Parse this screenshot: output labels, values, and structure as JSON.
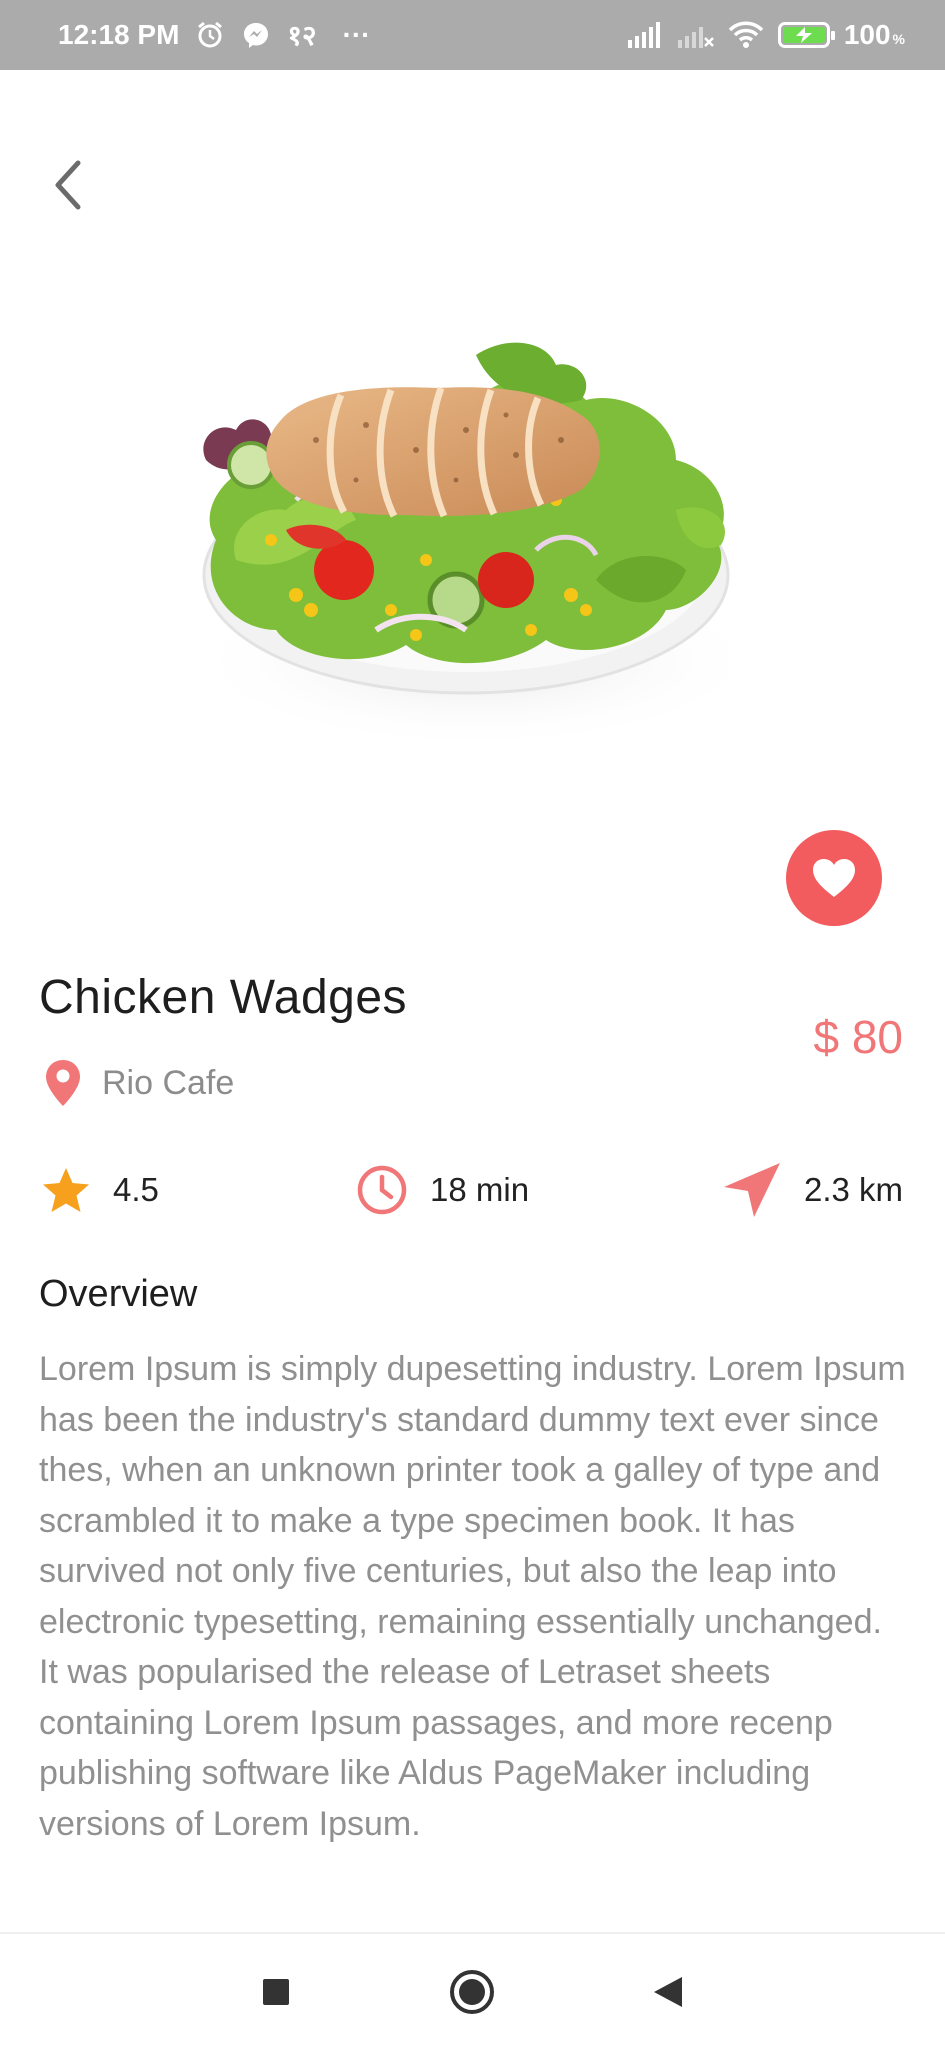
{
  "status_bar": {
    "time": "12:18 PM",
    "extra_icons": [
      "alarm-icon",
      "messenger-icon",
      "network-glyph-icon"
    ],
    "dots": "···",
    "network_glyph": "१२",
    "battery_percent": "100",
    "percent_sign": "%"
  },
  "food": {
    "name": "Chicken Wadges",
    "price": "$ 80",
    "restaurant": "Rio Cafe",
    "is_favorite": true
  },
  "stats": {
    "rating": "4.5",
    "time": "18 min",
    "distance": "2.3 km"
  },
  "overview": {
    "heading": "Overview",
    "text": "Lorem Ipsum is simply dupesetting industry. Lorem Ipsum has been the industry's standard dummy text ever since thes, when an unknown printer took a galley of type and scrambled it to make a type specimen book. It has survived not only five centuries, but also the leap into electronic typesetting, remaining essentially unchanged. It was popularised the release of Letraset sheets containing Lorem Ipsum passages, and more recenp publishing software like Aldus PageMaker including versions of Lorem Ipsum."
  },
  "colors": {
    "accent": "#f25c5e",
    "price": "#f07677",
    "star": "#f7a01d",
    "status_bar": "#ababab"
  }
}
